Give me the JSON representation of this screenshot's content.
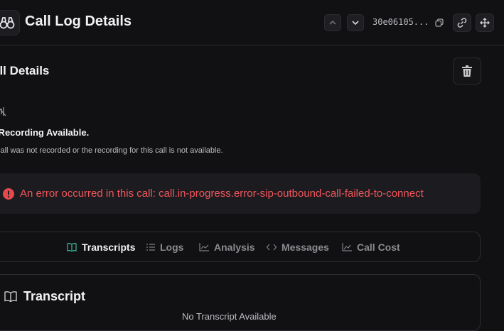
{
  "header": {
    "title": "Call Log Details",
    "call_id": "30e06105..."
  },
  "details": {
    "section_title": "all Details",
    "recording_title": "o Recording Available.",
    "recording_desc": "is call was not recorded or the recording for this call is not available."
  },
  "error": {
    "message": "An error occurred in this call: call.in-progress.error-sip-outbound-call-failed-to-connect",
    "color": "#f0565c"
  },
  "tabs": [
    {
      "label": "Transcripts",
      "icon": "book-open-icon",
      "active": true
    },
    {
      "label": "Logs",
      "icon": "list-icon",
      "active": false
    },
    {
      "label": "Analysis",
      "icon": "line-chart-icon",
      "active": false
    },
    {
      "label": "Messages",
      "icon": "code-icon",
      "active": false
    },
    {
      "label": "Call Cost",
      "icon": "area-chart-icon",
      "active": false
    }
  ],
  "transcript": {
    "title": "Transcript",
    "empty_text": "No Transcript Available"
  },
  "colors": {
    "accent": "#3fb9a0",
    "background": "#111113",
    "error": "#f0565c"
  }
}
